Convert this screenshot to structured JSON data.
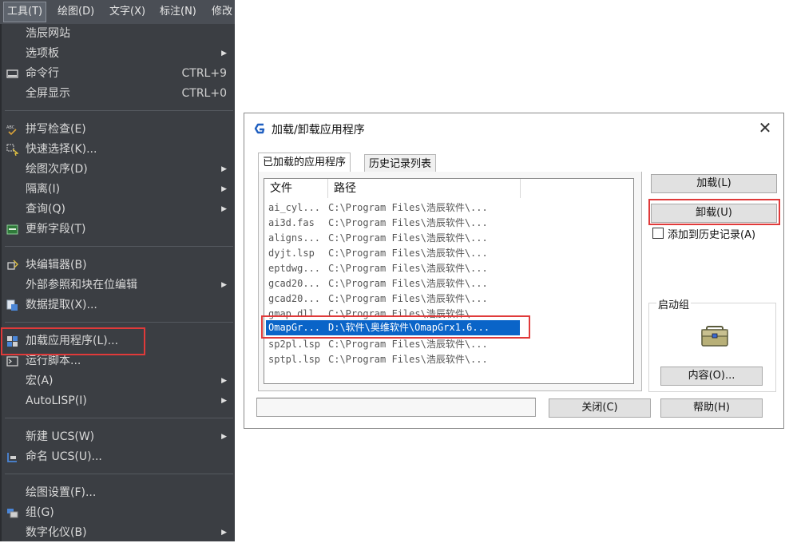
{
  "menubar": {
    "items": [
      "工具(T)",
      "绘图(D)",
      "文字(X)",
      "标注(N)",
      "修改"
    ]
  },
  "tools_menu": {
    "items": [
      {
        "label": "浩辰网站"
      },
      {
        "label": "选项板",
        "submenu": true
      },
      {
        "label": "命令行",
        "shortcut": "CTRL+9",
        "icon": "command-line-icon"
      },
      {
        "label": "全屏显示",
        "shortcut": "CTRL+0"
      },
      {
        "label": "拼写检查(E)",
        "icon": "spell-check-icon"
      },
      {
        "label": "快速选择(K)...",
        "icon": "quick-select-icon"
      },
      {
        "label": "绘图次序(D)",
        "submenu": true
      },
      {
        "label": "隔离(I)",
        "submenu": true
      },
      {
        "label": "查询(Q)",
        "submenu": true
      },
      {
        "label": "更新字段(T)",
        "icon": "update-field-icon"
      },
      {
        "label": "块编辑器(B)",
        "icon": "block-editor-icon"
      },
      {
        "label": "外部参照和块在位编辑",
        "submenu": true
      },
      {
        "label": "数据提取(X)...",
        "icon": "data-extraction-icon"
      },
      {
        "label": "加载应用程序(L)...",
        "icon": "load-application-icon",
        "highlighted": true
      },
      {
        "label": "运行脚本...",
        "icon": "run-script-icon"
      },
      {
        "label": "宏(A)",
        "submenu": true
      },
      {
        "label": "AutoLISP(I)",
        "submenu": true
      },
      {
        "label": "新建 UCS(W)",
        "submenu": true
      },
      {
        "label": "命名 UCS(U)...",
        "icon": "named-ucs-icon"
      },
      {
        "label": "绘图设置(F)..."
      },
      {
        "label": "组(G)",
        "icon": "group-icon"
      },
      {
        "label": "数字化仪(B)",
        "submenu": true
      }
    ]
  },
  "dialog": {
    "title": "加载/卸载应用程序",
    "tabs": [
      "已加载的应用程序",
      "历史记录列表"
    ],
    "columns": [
      "文件",
      "路径"
    ],
    "rows": [
      {
        "file": "ai_cyl...",
        "path": "C:\\Program Files\\浩辰软件\\..."
      },
      {
        "file": "ai3d.fas",
        "path": "C:\\Program Files\\浩辰软件\\..."
      },
      {
        "file": "aligns...",
        "path": "C:\\Program Files\\浩辰软件\\..."
      },
      {
        "file": "dyjt.lsp",
        "path": "C:\\Program Files\\浩辰软件\\..."
      },
      {
        "file": "eptdwg...",
        "path": "C:\\Program Files\\浩辰软件\\..."
      },
      {
        "file": "gcad20...",
        "path": "C:\\Program Files\\浩辰软件\\..."
      },
      {
        "file": "gcad20...",
        "path": "C:\\Program Files\\浩辰软件\\..."
      },
      {
        "file": "gmap.dll",
        "path": "C:\\Program Files\\浩辰软件\\..."
      },
      {
        "file": "OmapGr...",
        "path": "D:\\软件\\奥维软件\\OmapGrx1.6...",
        "selected": true
      },
      {
        "file": "sp2pl.lsp",
        "path": "C:\\Program Files\\浩辰软件\\..."
      },
      {
        "file": "sptpl.lsp",
        "path": "C:\\Program Files\\浩辰软件\\..."
      }
    ],
    "load_button": "加载(L)",
    "unload_button": "卸载(U)",
    "add_history_label": "添加到历史记录(A)",
    "add_history_checked": false,
    "startup_group_label": "启动组",
    "contents_button": "内容(O)...",
    "close_button": "关闭(C)",
    "help_button": "帮助(H)",
    "status_text": ""
  },
  "colors": {
    "menu_bg": "#3b3e43",
    "menubar_bg": "#4a4e55",
    "highlight_red": "#e03a3a",
    "selection_blue": "#0a64c8"
  }
}
